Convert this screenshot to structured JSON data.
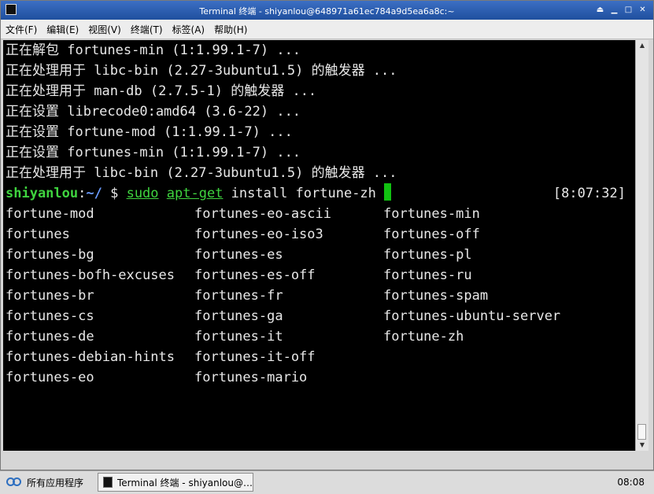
{
  "window": {
    "title": "Terminal 终端 - shiyanlou@648971a61ec784a9d5ea6a8c:~",
    "buttons": [
      "⏏",
      "▁",
      "□",
      "✕"
    ]
  },
  "menu": [
    "文件(F)",
    "编辑(E)",
    "视图(V)",
    "终端(T)",
    "标签(A)",
    "帮助(H)"
  ],
  "terminal": {
    "lines": [
      "正在解包 fortunes-min (1:1.99.1-7) ...",
      "正在处理用于 libc-bin (2.27-3ubuntu1.5) 的触发器 ...",
      "正在处理用于 man-db (2.7.5-1) 的触发器 ...",
      "正在设置 librecode0:amd64 (3.6-22) ...",
      "正在设置 fortune-mod (1:1.99.1-7) ...",
      "正在设置 fortunes-min (1:1.99.1-7) ...",
      "正在处理用于 libc-bin (2.27-3ubuntu1.5) 的触发器 ..."
    ],
    "prompt": {
      "user": "shiyanlou",
      "sep": ":",
      "path": "~/",
      "dollar": " $ ",
      "sudo": "sudo",
      "space": " ",
      "aptget": "apt-get",
      "rest": " install fortune-zh ",
      "time": "[8:07:32]"
    },
    "completions": [
      "fortune-mod",
      "fortunes-eo-ascii",
      "fortunes-min",
      "fortunes",
      "fortunes-eo-iso3",
      "fortunes-off",
      "fortunes-bg",
      "fortunes-es",
      "fortunes-pl",
      "fortunes-bofh-excuses",
      "fortunes-es-off",
      "fortunes-ru",
      "fortunes-br",
      "fortunes-fr",
      "fortunes-spam",
      "fortunes-cs",
      "fortunes-ga",
      "fortunes-ubuntu-server",
      "fortunes-de",
      "fortunes-it",
      "fortune-zh",
      "fortunes-debian-hints",
      "fortunes-it-off",
      "",
      "fortunes-eo",
      "fortunes-mario",
      ""
    ]
  },
  "taskbar": {
    "start_label": "所有应用程序",
    "task_label": "Terminal 终端 - shiyanlou@…",
    "clock": "08:08"
  }
}
